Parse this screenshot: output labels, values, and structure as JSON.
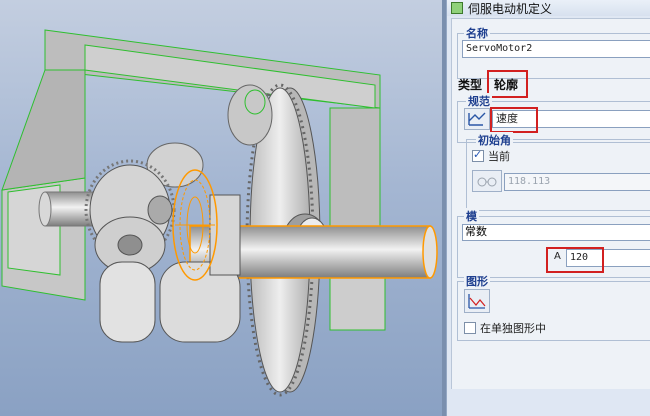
{
  "window": {
    "title": "伺服电动机定义"
  },
  "name_section": {
    "label": "名称",
    "value": "ServoMotor2"
  },
  "tabs": [
    {
      "label": "类型"
    },
    {
      "label": "轮廓"
    }
  ],
  "spec_section": {
    "label": "规范",
    "value": "速度"
  },
  "initial_angle": {
    "label": "初始角",
    "current_label": "当前",
    "current_checked": true,
    "value": "118.113"
  },
  "module_section": {
    "label": "模",
    "value": "常数",
    "param_label": "A",
    "param_value": "120"
  },
  "graph_section": {
    "label": "图形",
    "separate_graph_label": "在单独图形中",
    "separate_graph_checked": false
  },
  "colors": {
    "highlight": "#d22020",
    "selection": "#ff9900",
    "frame": "#2fbf2f",
    "dialog_bg": "#eef2f7"
  },
  "icons": [
    "dialog-icon",
    "spec-icon",
    "measure-icon",
    "graph-icon"
  ]
}
